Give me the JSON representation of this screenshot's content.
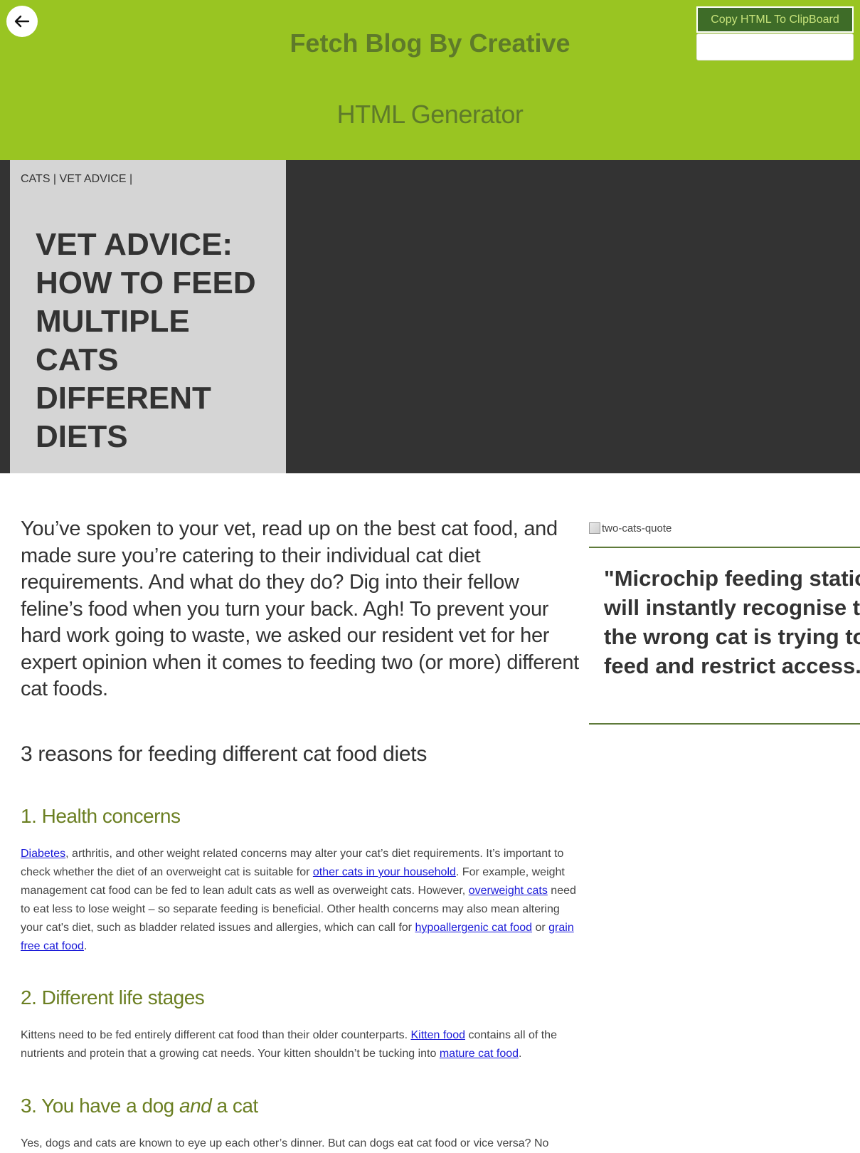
{
  "header": {
    "back_icon": "arrow-left-icon",
    "title": "Fetch Blog By Creative",
    "subtitle": "HTML Generator",
    "copy_button_label": "Copy HTML To ClipBoard",
    "colors": {
      "header_bg": "#99c522",
      "title": "#5e7a2a",
      "copy_bg": "#3e6c28"
    }
  },
  "hero": {
    "breadcrumb": "CATS | VET ADVICE |",
    "title": "VET ADVICE: HOW TO FEED MULTIPLE CATS DIFFERENT DIETS",
    "colors": {
      "panel_bg": "#d5d5d5",
      "hero_bg": "#333333"
    }
  },
  "article": {
    "intro": "You’ve spoken to your vet, read up on the best cat food, and made sure you’re catering to their individual cat diet requirements. And what do they do? Dig into their fellow feline’s food when you turn your back. Agh! To prevent your hard work going to waste, we asked our resident vet for her expert opinion when it comes to feeding two (or more) different cat foods.",
    "section_heading": "3 reasons for feeding different cat food diets",
    "health": {
      "heading": "1. Health concerns",
      "link_diabetes": "Diabetes",
      "text_1": ", arthritis, and other weight related concerns may alter your cat’s diet requirements. It’s important to check whether the diet of an overweight cat is suitable for ",
      "link_other_cats": "other cats in your household",
      "text_2": ". For example, weight management cat food can be fed to lean adult cats as well as overweight cats. However, ",
      "link_overweight": "overweight cats",
      "text_3": " need to eat less to lose weight – so separate feeding is beneficial. Other health concerns may also mean altering your cat's diet, such as bladder related issues and allergies, which can call for ",
      "link_hypoallergenic": "hypoallergenic cat food",
      "text_4": " or ",
      "link_grain_free": "grain free cat food",
      "text_5": "."
    },
    "life_stages": {
      "heading": "2. Different life stages",
      "text_1": "Kittens need to be fed entirely different cat food than their older counterparts. ",
      "link_kitten": "Kitten food",
      "text_2": " contains all of the nutrients and protein that a growing cat needs. Your kitten shouldn’t be tucking into ",
      "link_mature": "mature cat food",
      "text_3": "."
    },
    "dog_and_cat": {
      "heading_pre": "3. You have a dog ",
      "heading_em": "and",
      "heading_post": " a cat",
      "text": "Yes, dogs and cats are known to eye up each other’s dinner. But can dogs eat cat food or vice versa? No"
    },
    "link_color": "#1a1ad8",
    "subheading_color": "#6b7f22"
  },
  "sidebar": {
    "image_alt": "two-cats-quote",
    "quote": "\"Microchip feeding stations will instantly recognise that the wrong cat is trying to feed and restrict access.\"",
    "border_color": "#5e7a3a"
  }
}
